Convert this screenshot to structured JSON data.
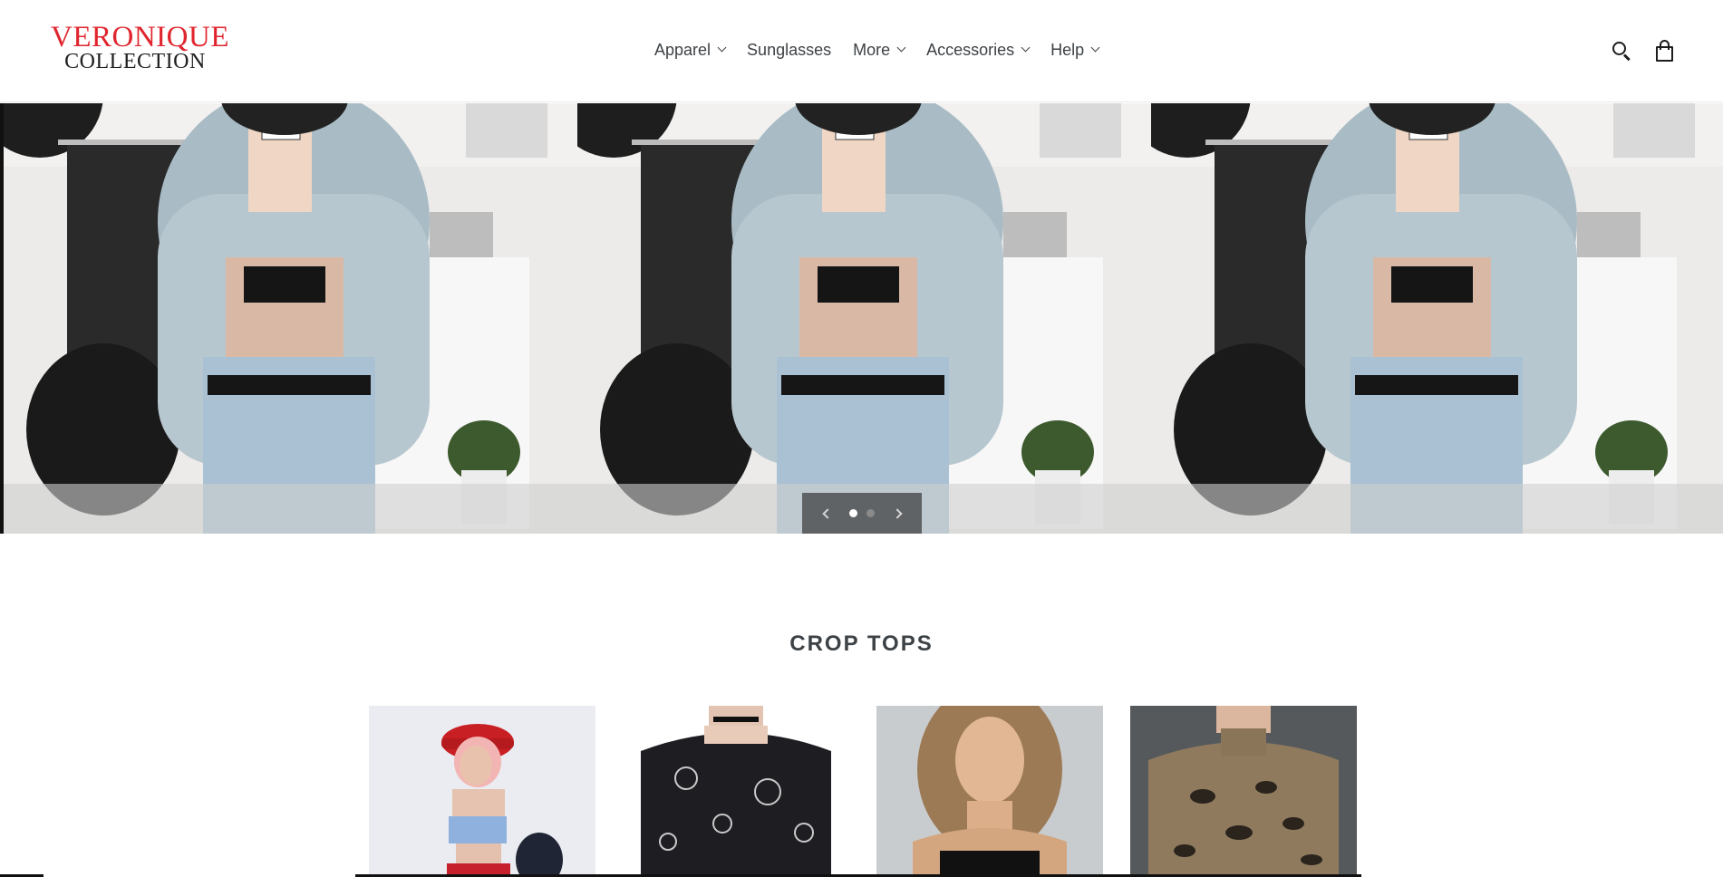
{
  "brand": {
    "logo_line1": "VERONIQUE",
    "logo_line2": "COLLECTION",
    "logo_color": "#e0252e"
  },
  "nav": {
    "items": [
      {
        "label": "Apparel",
        "has_dropdown": true
      },
      {
        "label": "Sunglasses",
        "has_dropdown": false
      },
      {
        "label": "More",
        "has_dropdown": true
      },
      {
        "label": "Accessories",
        "has_dropdown": true
      },
      {
        "label": "Help",
        "has_dropdown": true
      }
    ]
  },
  "header_icons": [
    "search-icon",
    "cart-icon"
  ],
  "slideshow": {
    "slide_count": 2,
    "active_index": 0,
    "image_description_icon": "denim-jacket-mirror-selfie"
  },
  "section": {
    "title": "CROP TOPS"
  },
  "products": [
    {
      "image_icon": "pink-hair-red-hat-crop-top"
    },
    {
      "image_icon": "mesh-sun-moon-crop-top"
    },
    {
      "image_icon": "black-cami-crop-top"
    },
    {
      "image_icon": "snakeskin-crop-top"
    }
  ]
}
